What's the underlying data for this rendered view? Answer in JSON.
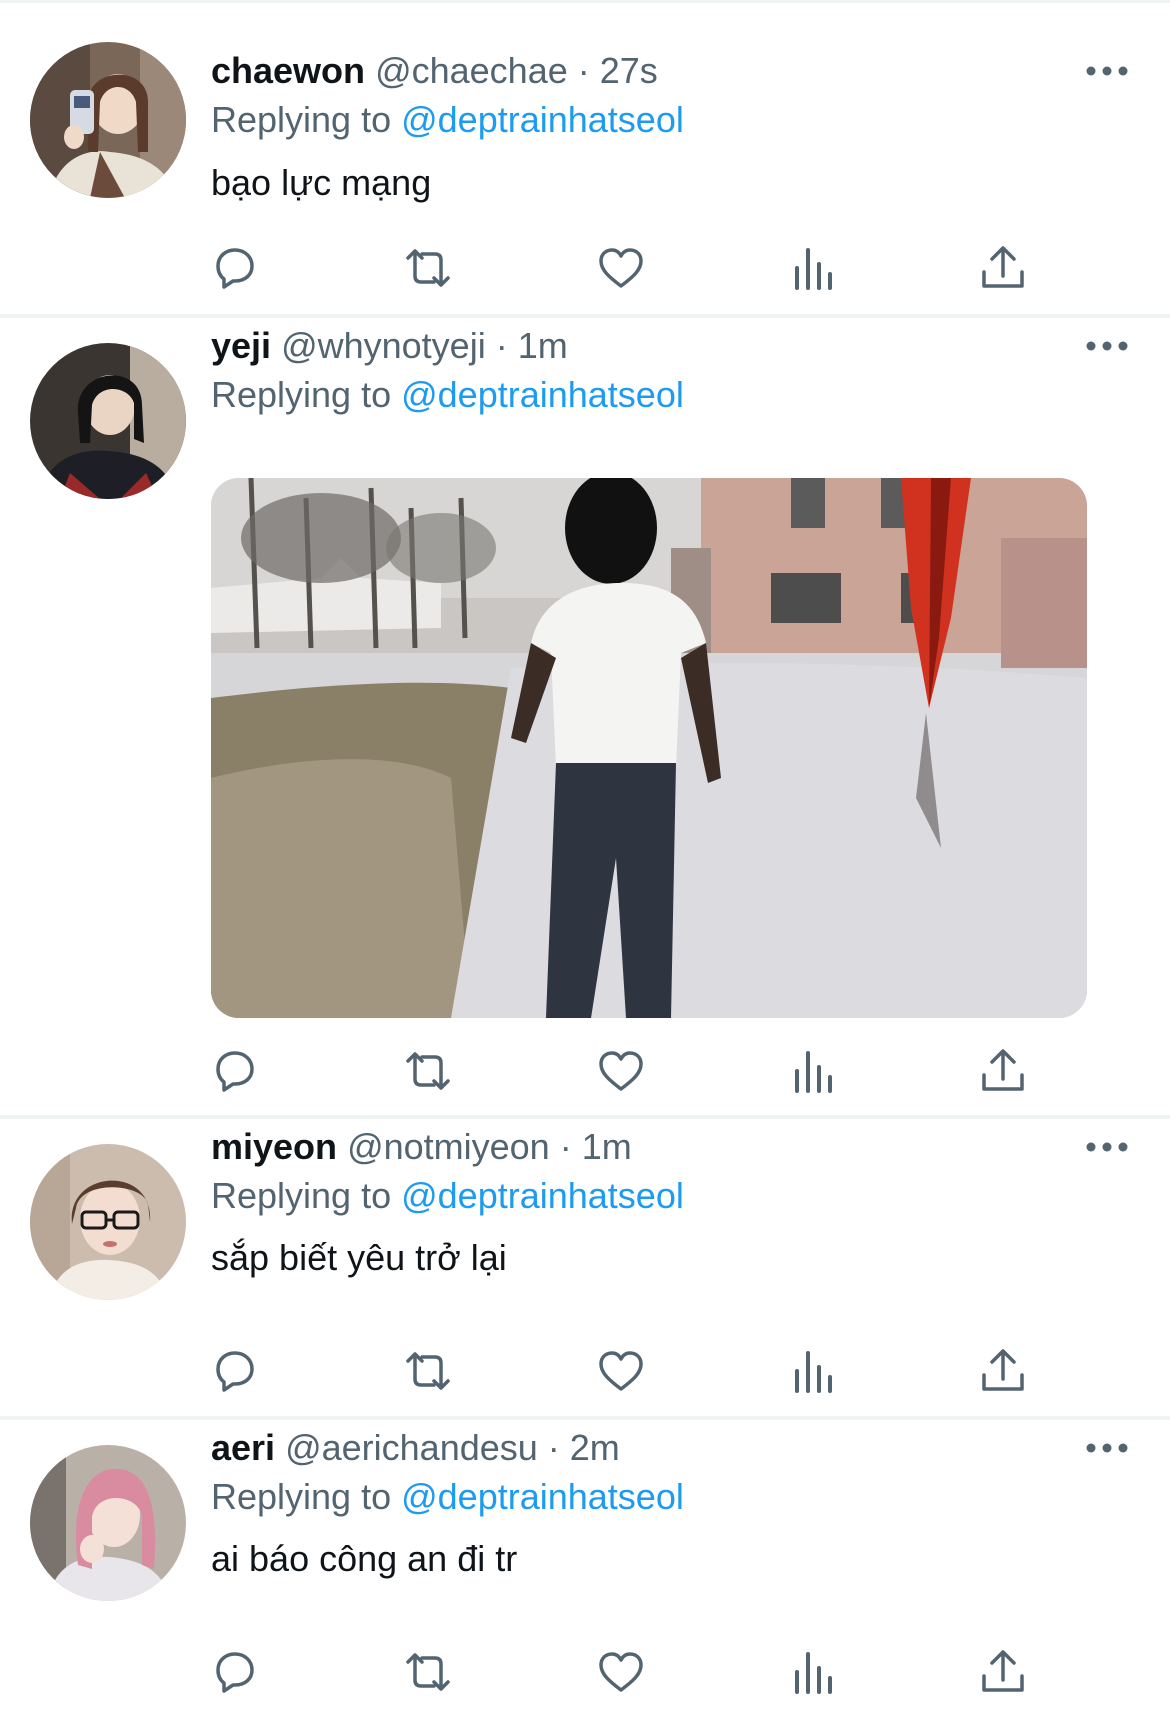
{
  "colors": {
    "accent": "#1d9bf0",
    "secondary": "#536471",
    "text": "#0f1419",
    "divider": "#eff3f4"
  },
  "icons": [
    "reply-icon",
    "retweet-icon",
    "like-icon",
    "views-icon",
    "share-icon",
    "more-icon"
  ],
  "tweets": [
    {
      "name": "chaewon",
      "handle": "@chaechae",
      "sep": " · ",
      "time": "27s",
      "replying_prefix": "Replying to ",
      "replying_to": "@deptrainhatseol",
      "text": "bạo lực mạng"
    },
    {
      "name": "yeji",
      "handle": "@whynotyeji",
      "sep": " · ",
      "time": "1m",
      "replying_prefix": "Replying to ",
      "replying_to": "@deptrainhatseol",
      "text": "",
      "has_media": true
    },
    {
      "name": "miyeon",
      "handle": "@notmiyeon",
      "sep": " · ",
      "time": "1m",
      "replying_prefix": "Replying to ",
      "replying_to": "@deptrainhatseol",
      "text": "sắp biết yêu trở lại"
    },
    {
      "name": "aeri",
      "handle": "@aerichandesu",
      "sep": " · ",
      "time": "2m",
      "replying_prefix": "Replying to ",
      "replying_to": "@deptrainhatseol",
      "text": "ai báo công an đi tr"
    }
  ]
}
